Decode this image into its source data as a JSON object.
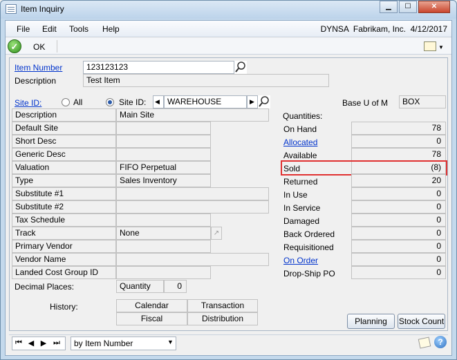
{
  "window": {
    "title": "Item Inquiry"
  },
  "menu": {
    "file": "File",
    "edit": "Edit",
    "tools": "Tools",
    "help": "Help"
  },
  "header": {
    "company": "DYNSA  Fabrikam, Inc.  4/12/2017"
  },
  "toolbar": {
    "ok": "OK"
  },
  "item": {
    "number_label": "Item Number",
    "number_value": "123123123",
    "description_label": "Description",
    "description_value": "Test Item"
  },
  "site": {
    "site_id_link": "Site ID:",
    "all_label": "All",
    "site_id_label": "Site ID:",
    "site_id_value": "WAREHOUSE"
  },
  "base_uom": {
    "label": "Base U of M",
    "value": "BOX"
  },
  "details": [
    {
      "label": "Description",
      "value": "Main Site"
    },
    {
      "label": "Default Site",
      "value": ""
    },
    {
      "label": "Short Desc",
      "value": ""
    },
    {
      "label": "Generic Desc",
      "value": ""
    },
    {
      "label": "Valuation",
      "value": "FIFO Perpetual"
    },
    {
      "label": "Type",
      "value": "Sales Inventory"
    },
    {
      "label": "Substitute #1",
      "value": ""
    },
    {
      "label": "Substitute #2",
      "value": ""
    },
    {
      "label": "Tax Schedule",
      "value": ""
    },
    {
      "label": "Track",
      "value": "None"
    },
    {
      "label": "Primary Vendor",
      "value": ""
    },
    {
      "label": "Vendor Name",
      "value": ""
    },
    {
      "label": "Landed Cost Group ID",
      "value": ""
    }
  ],
  "decimal": {
    "label": "Decimal Places:",
    "quantity_label": "Quantity",
    "quantity_value": "0"
  },
  "history": {
    "label": "History:",
    "calendar": "Calendar",
    "transaction": "Transaction",
    "fiscal": "Fiscal",
    "distribution": "Distribution"
  },
  "quantities": {
    "heading": "Quantities:",
    "rows": [
      {
        "label": "On Hand",
        "value": "78"
      },
      {
        "label": "Allocated",
        "value": "0"
      },
      {
        "label": "Available",
        "value": "78"
      },
      {
        "label": "Sold",
        "value": "(8)"
      },
      {
        "label": "Returned",
        "value": "20"
      },
      {
        "label": "In Use",
        "value": "0"
      },
      {
        "label": "In Service",
        "value": "0"
      },
      {
        "label": "Damaged",
        "value": "0"
      },
      {
        "label": "Back Ordered",
        "value": "0"
      },
      {
        "label": "Requisitioned",
        "value": "0"
      },
      {
        "label": "On Order",
        "value": "0"
      },
      {
        "label": "Drop-Ship PO",
        "value": "0"
      }
    ]
  },
  "buttons": {
    "planning": "Planning",
    "stock_count": "Stock Count"
  },
  "footer": {
    "sort_by": "by Item Number"
  },
  "colors": {
    "highlight": "#e03030",
    "link": "#0033cc"
  }
}
